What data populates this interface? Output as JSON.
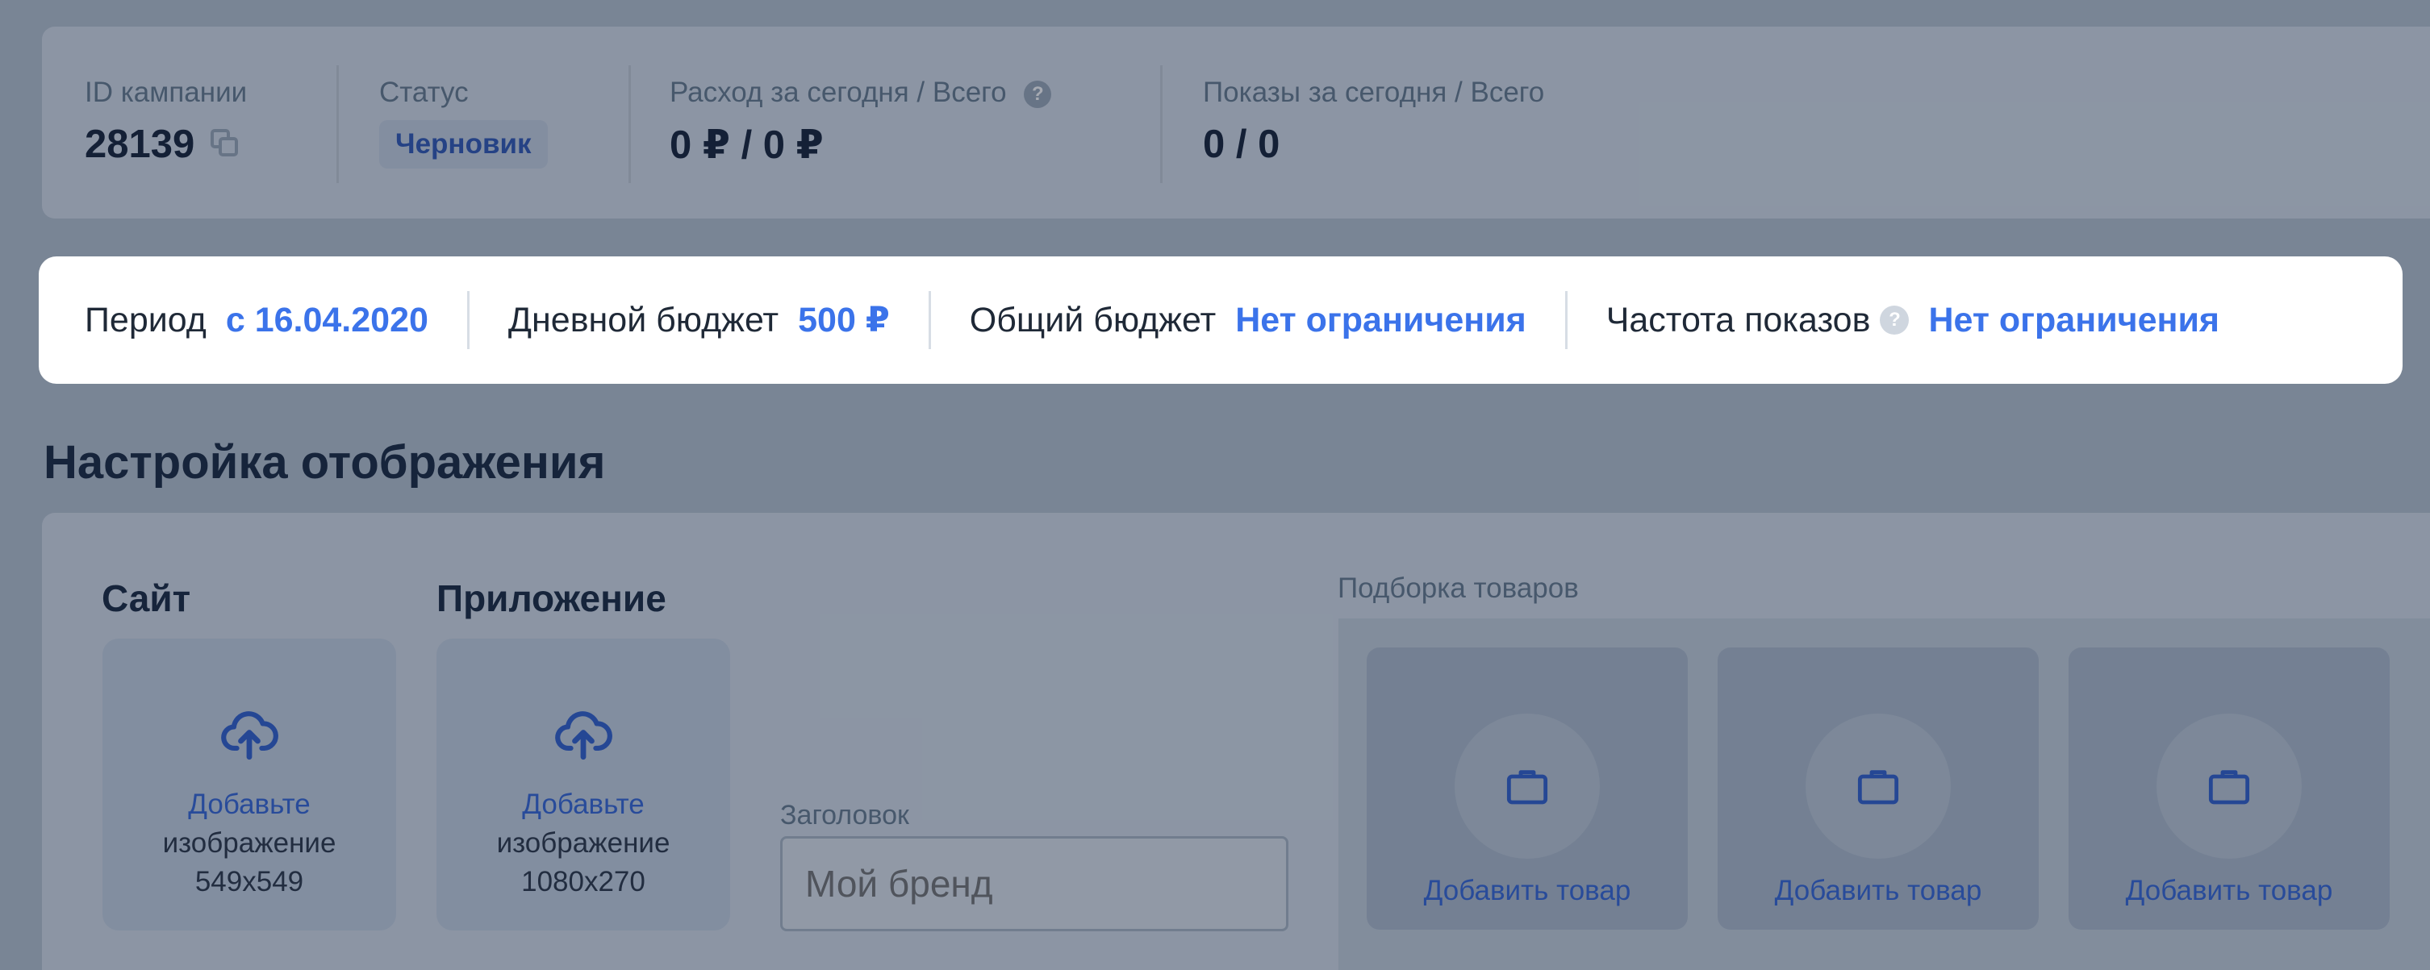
{
  "campaign_stats": {
    "id_label": "ID кампании",
    "id_value": "28139",
    "status_label": "Статус",
    "status_value": "Черновик",
    "spend_label": "Расход за сегодня / Всего",
    "spend_value": "0 ₽  / 0 ₽",
    "impressions_label": "Показы за сегодня / Всего",
    "impressions_value": "0  / 0"
  },
  "budget_bar": {
    "period_label": "Период",
    "period_value": "с 16.04.2020",
    "daily_budget_label": "Дневной бюджет",
    "daily_budget_value": "500 ₽",
    "total_budget_label": "Общий бюджет",
    "total_budget_value": "Нет ограничения",
    "frequency_label": "Частота показов",
    "frequency_value": "Нет ограничения"
  },
  "display_settings": {
    "title": "Настройка отображения",
    "site": {
      "title": "Сайт",
      "upload_link": "Добавьте",
      "upload_text": "изображение",
      "size": "549x549"
    },
    "app": {
      "title": "Приложение",
      "upload_link": "Добавьте",
      "upload_text": "изображение",
      "size": "1080x270"
    },
    "headline": {
      "label": "Заголовок",
      "placeholder": "Мой бренд"
    },
    "products": {
      "label": "Подборка товаров",
      "items": [
        {
          "label": "Добавить товар"
        },
        {
          "label": "Добавить товар"
        },
        {
          "label": "Добавить товар"
        }
      ]
    }
  },
  "colors": {
    "accent": "#3b73ea",
    "heading": "#18273f",
    "overlay": "rgba(20,32,52,0.38)"
  },
  "icons": [
    "copy-icon",
    "help-icon",
    "upload-cloud-icon",
    "briefcase-icon"
  ]
}
